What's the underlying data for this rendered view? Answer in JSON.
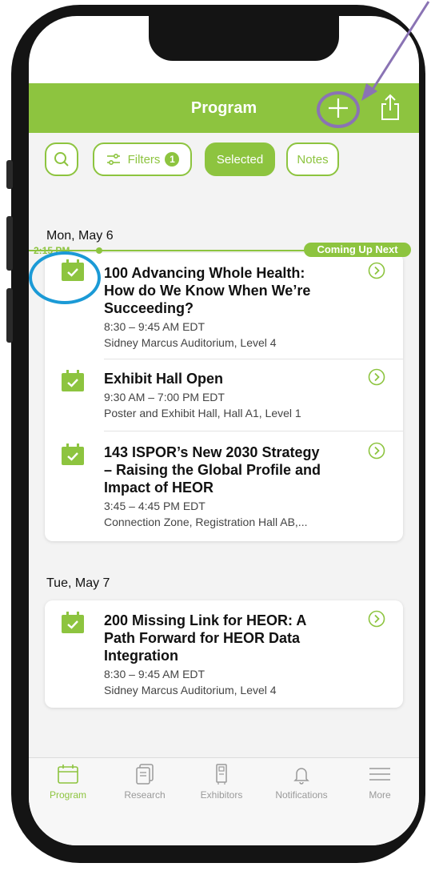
{
  "header": {
    "title": "Program"
  },
  "toolbar": {
    "filters_label": "Filters",
    "filters_count": "1",
    "selected_label": "Selected",
    "notes_label": "Notes"
  },
  "days": [
    {
      "date": "Mon, May 6",
      "now_time": "2:15 PM",
      "coming_up_label": "Coming Up Next",
      "sessions": [
        {
          "title_line1": "100 Advancing Whole Health:",
          "title_line2": "How do We Know When We’re",
          "title_line3": "Succeeding?",
          "time": "8:30 – 9:45 AM EDT",
          "location": "Sidney Marcus Auditorium, Level 4"
        },
        {
          "title_line1": "Exhibit Hall Open",
          "time": "9:30 AM – 7:00 PM EDT",
          "location": "Poster and Exhibit Hall, Hall A1, Level 1"
        },
        {
          "title_line1": "143 ISPOR’s New 2030 Strategy",
          "title_line2": "– Raising the Global Profile and",
          "title_line3": "Impact of HEOR",
          "time": "3:45 – 4:45 PM EDT",
          "location": "Connection Zone, Registration Hall AB,..."
        }
      ]
    },
    {
      "date": "Tue, May 7",
      "sessions": [
        {
          "title_line1": "200 Missing Link for HEOR: A",
          "title_line2": "Path Forward for HEOR Data",
          "title_line3": "Integration",
          "time": "8:30 – 9:45 AM EDT",
          "location": "Sidney Marcus Auditorium, Level 4"
        }
      ]
    }
  ],
  "tabs": [
    {
      "label": "Program",
      "icon": "calendar-icon",
      "active": true
    },
    {
      "label": "Research",
      "icon": "documents-icon"
    },
    {
      "label": "Exhibitors",
      "icon": "booth-icon"
    },
    {
      "label": "Notifications",
      "icon": "bell-icon"
    },
    {
      "label": "More",
      "icon": "menu-icon"
    }
  ],
  "colors": {
    "brand": "#8dc43f",
    "annotation_circle": "#1b9ad6",
    "annotation_arrow": "#8a73b4"
  }
}
